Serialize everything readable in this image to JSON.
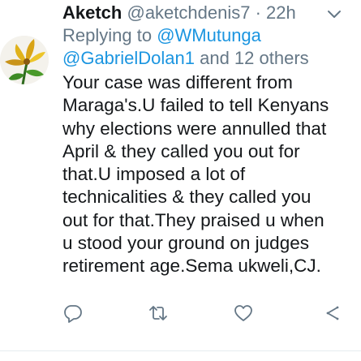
{
  "tweet": {
    "display_name": "Aketch",
    "handle": "@aketchdenis7",
    "separator": "·",
    "time": "22h",
    "reply_prefix": "Replying to ",
    "reply_mention_1": "@WMutunga",
    "reply_mention_2": "@GabrielDolan1",
    "reply_suffix": " and 12 others",
    "text": "Your case was different from Maraga's.U failed to tell Kenyans why elections were annulled that April & they called you out for that.U imposed a lot of technicalities & they called you out for that.They praised u when u stood your ground on judges retirement age.Sema ukweli,CJ.",
    "icons": {
      "avatar": "flower-avatar",
      "menu": "chevron-down-icon",
      "reply": "reply-icon",
      "retweet": "retweet-icon",
      "like": "heart-icon",
      "share": "share-icon"
    }
  },
  "colors": {
    "text": "#14171a",
    "secondary": "#657786",
    "link": "#1b95e0",
    "icon": "#657786"
  }
}
